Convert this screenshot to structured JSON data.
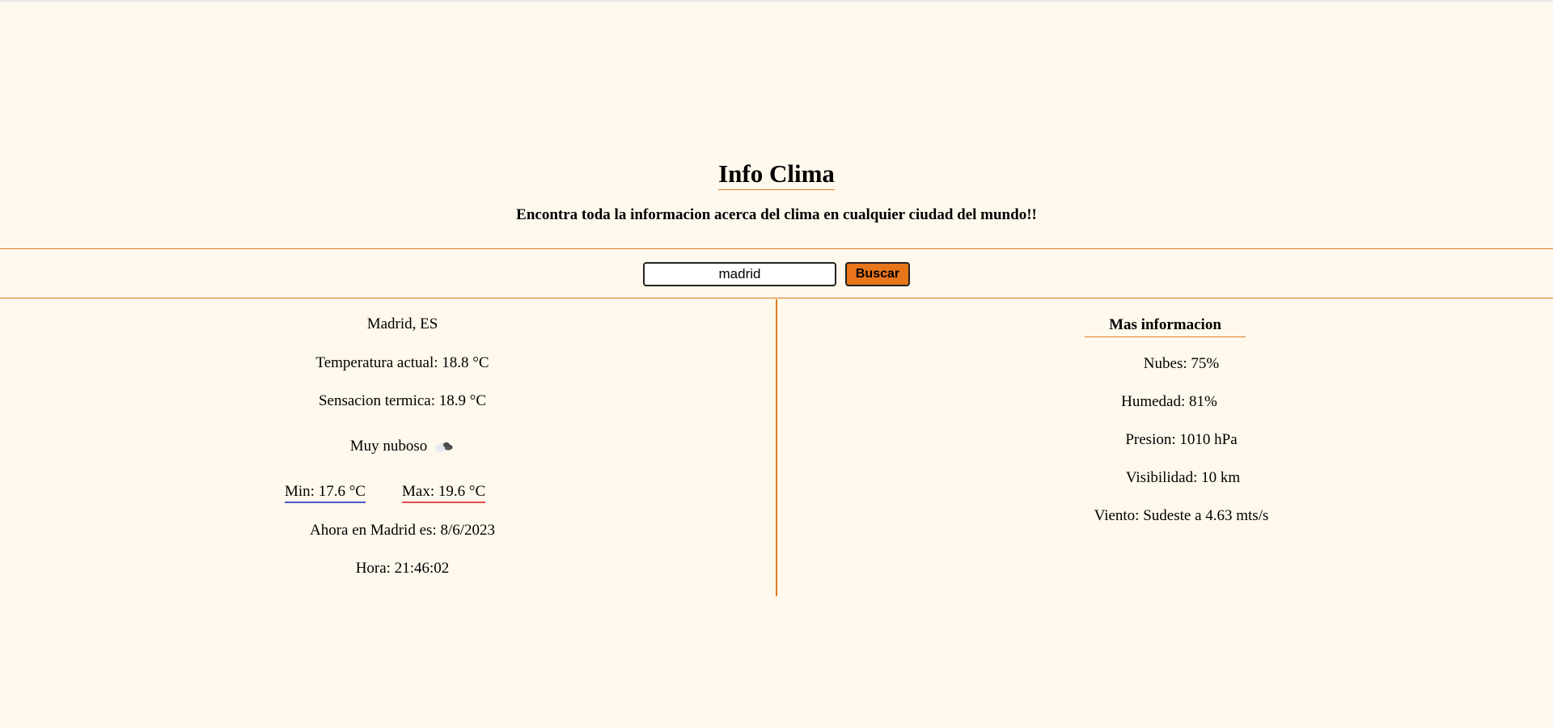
{
  "header": {
    "title": "Info Clima",
    "subtitle": "Encontra toda la informacion acerca del clima en cualquier ciudad del mundo!!"
  },
  "search": {
    "value": "madrid",
    "button_label": "Buscar"
  },
  "current": {
    "location": "Madrid, ES",
    "temperature": "Temperatura actual: 18.8 °C",
    "feels_like": "Sensacion termica: 18.9 °C",
    "description": "Muy nuboso",
    "icon": "broken-clouds-icon",
    "min": "Min: 17.6 °C",
    "max": "Max: 19.6 °C",
    "date": "Ahora en Madrid es: 8/6/2023",
    "time": "Hora: 21:46:02"
  },
  "more_info": {
    "title": "Mas informacion",
    "clouds": "Nubes: 75%",
    "humidity": "Humedad: 81%",
    "pressure": "Presion: 1010 hPa",
    "visibility": "Visibilidad: 10 km",
    "wind": "Viento: Sudeste a 4.63 mts/s"
  },
  "colors": {
    "background": "#fff8ec",
    "accent": "#e07a20",
    "button": "#e8751a",
    "min_underline": "#4d5bd6",
    "max_underline": "#e05050"
  }
}
